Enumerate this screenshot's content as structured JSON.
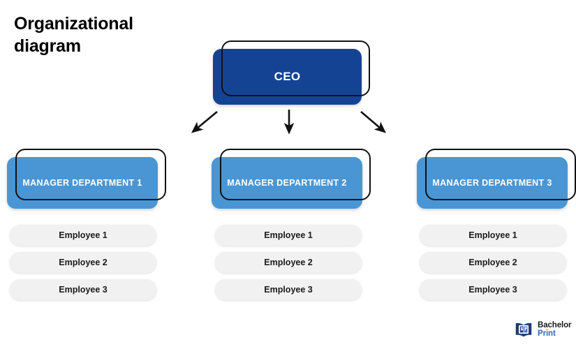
{
  "title": {
    "line1": "Organizational",
    "line2": "diagram"
  },
  "ceo": {
    "label": "CEO",
    "fill_color": "#154394",
    "outline_color": "#111111"
  },
  "managers": [
    {
      "label": "MANAGER DEPARTMENT 1",
      "fill_color": "#4A96D4"
    },
    {
      "label": "MANAGER DEPARTMENT 2",
      "fill_color": "#4A96D4"
    },
    {
      "label": "MANAGER DEPARTMENT 3",
      "fill_color": "#4A96D4"
    }
  ],
  "employee_columns": [
    {
      "employees": [
        "Employee 1",
        "Employee 2",
        "Employee 3"
      ]
    },
    {
      "employees": [
        "Employee 1",
        "Employee 2",
        "Employee 3"
      ]
    },
    {
      "employees": [
        "Employee 1",
        "Employee 2",
        "Employee 3"
      ]
    }
  ],
  "employee_style": {
    "fill_color": "#F1F1F1",
    "text_color": "#1A1A1A"
  },
  "arrows": [
    {
      "name": "ceo-to-manager-1",
      "direction": "down-left"
    },
    {
      "name": "ceo-to-manager-2",
      "direction": "down"
    },
    {
      "name": "ceo-to-manager-3",
      "direction": "down-right"
    }
  ],
  "logo": {
    "icon": "open-book-bp-monogram-icon",
    "word_primary": "Bachelor",
    "word_secondary": "Print",
    "primary_color": "#16181C",
    "secondary_color": "#2D6CB8",
    "mark_color": "#1F3B73"
  }
}
